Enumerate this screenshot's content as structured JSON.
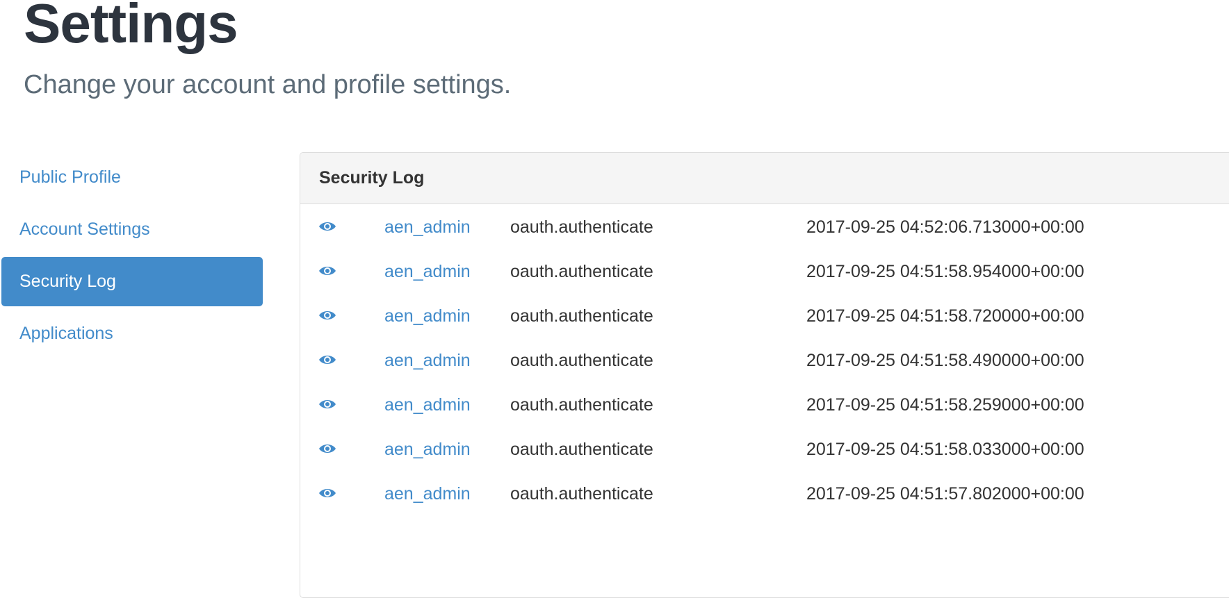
{
  "header": {
    "title": "Settings",
    "subtitle": "Change your account and profile settings."
  },
  "sidebar": {
    "items": [
      {
        "label": "Public Profile",
        "active": false
      },
      {
        "label": "Account Settings",
        "active": false
      },
      {
        "label": "Security Log",
        "active": true
      },
      {
        "label": "Applications",
        "active": false
      }
    ]
  },
  "security_log": {
    "heading": "Security Log",
    "view_icon": "eye-icon",
    "rows": [
      {
        "user": "aen_admin",
        "action": "oauth.authenticate",
        "timestamp": "2017-09-25 04:52:06.713000+00:00"
      },
      {
        "user": "aen_admin",
        "action": "oauth.authenticate",
        "timestamp": "2017-09-25 04:51:58.954000+00:00"
      },
      {
        "user": "aen_admin",
        "action": "oauth.authenticate",
        "timestamp": "2017-09-25 04:51:58.720000+00:00"
      },
      {
        "user": "aen_admin",
        "action": "oauth.authenticate",
        "timestamp": "2017-09-25 04:51:58.490000+00:00"
      },
      {
        "user": "aen_admin",
        "action": "oauth.authenticate",
        "timestamp": "2017-09-25 04:51:58.259000+00:00"
      },
      {
        "user": "aen_admin",
        "action": "oauth.authenticate",
        "timestamp": "2017-09-25 04:51:58.033000+00:00"
      },
      {
        "user": "aen_admin",
        "action": "oauth.authenticate",
        "timestamp": "2017-09-25 04:51:57.802000+00:00"
      }
    ]
  },
  "colors": {
    "accent": "#428bca",
    "title": "#2d343e",
    "subtitle": "#5c6b77",
    "panel_heading_bg": "#f5f5f5"
  }
}
